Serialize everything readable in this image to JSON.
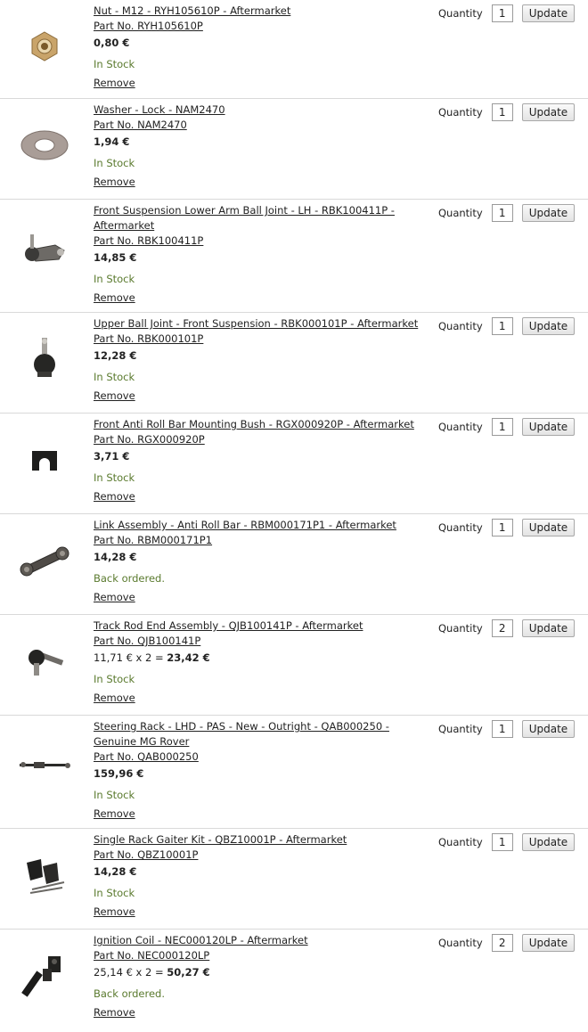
{
  "labels": {
    "quantity": "Quantity",
    "update": "Update",
    "remove": "Remove",
    "part_prefix": "Part No."
  },
  "items": [
    {
      "title": "Nut - M12 - RYH105610P - Aftermarket",
      "part_no": "Part No. RYH105610P",
      "price": "0,80 €",
      "calc": "",
      "stock": "In Stock",
      "qty": "1",
      "icon": "nut-icon"
    },
    {
      "title": "Washer - Lock - NAM2470",
      "part_no": "Part No. NAM2470",
      "price": "1,94 €",
      "calc": "",
      "stock": "In Stock",
      "qty": "1",
      "icon": "washer-icon"
    },
    {
      "title": "Front Suspension Lower Arm Ball Joint - LH - RBK100411P - Aftermarket",
      "part_no": "Part No. RBK100411P",
      "price": "14,85 €",
      "calc": "",
      "stock": "In Stock",
      "qty": "1",
      "icon": "ball-joint-arm-icon"
    },
    {
      "title": "Upper Ball Joint - Front Suspension - RBK000101P - Aftermarket",
      "part_no": "Part No. RBK000101P",
      "price": "12,28 €",
      "calc": "",
      "stock": "In Stock",
      "qty": "1",
      "icon": "ball-joint-icon"
    },
    {
      "title": "Front Anti Roll Bar Mounting Bush - RGX000920P - Aftermarket",
      "part_no": "Part No. RGX000920P",
      "price": "3,71 €",
      "calc": "",
      "stock": "In Stock",
      "qty": "1",
      "icon": "bush-icon"
    },
    {
      "title": "Link Assembly - Anti Roll Bar - RBM000171P1 - Aftermarket",
      "part_no": "Part No. RBM000171P1",
      "price": "14,28 €",
      "calc": "",
      "stock": "Back ordered.",
      "qty": "1",
      "icon": "link-assembly-icon"
    },
    {
      "title": "Track Rod End Assembly - QJB100141P - Aftermarket",
      "part_no": "Part No. QJB100141P",
      "price": "23,42 €",
      "calc": "11,71 € x 2 = ",
      "stock": "In Stock",
      "qty": "2",
      "icon": "track-rod-end-icon"
    },
    {
      "title": "Steering Rack - LHD - PAS - New - Outright - QAB000250 - Genuine MG Rover",
      "part_no": "Part No. QAB000250",
      "price": "159,96 €",
      "calc": "",
      "stock": "In Stock",
      "qty": "1",
      "icon": "steering-rack-icon"
    },
    {
      "title": "Single Rack Gaiter Kit - QBZ10001P - Aftermarket",
      "part_no": "Part No. QBZ10001P",
      "price": "14,28 €",
      "calc": "",
      "stock": "In Stock",
      "qty": "1",
      "icon": "gaiter-kit-icon"
    },
    {
      "title": "Ignition Coil - NEC000120LP - Aftermarket",
      "part_no": "Part No. NEC000120LP",
      "price": "50,27 €",
      "calc": "25,14 € x 2 = ",
      "stock": "Back ordered.",
      "qty": "2",
      "icon": "ignition-coil-icon"
    }
  ]
}
